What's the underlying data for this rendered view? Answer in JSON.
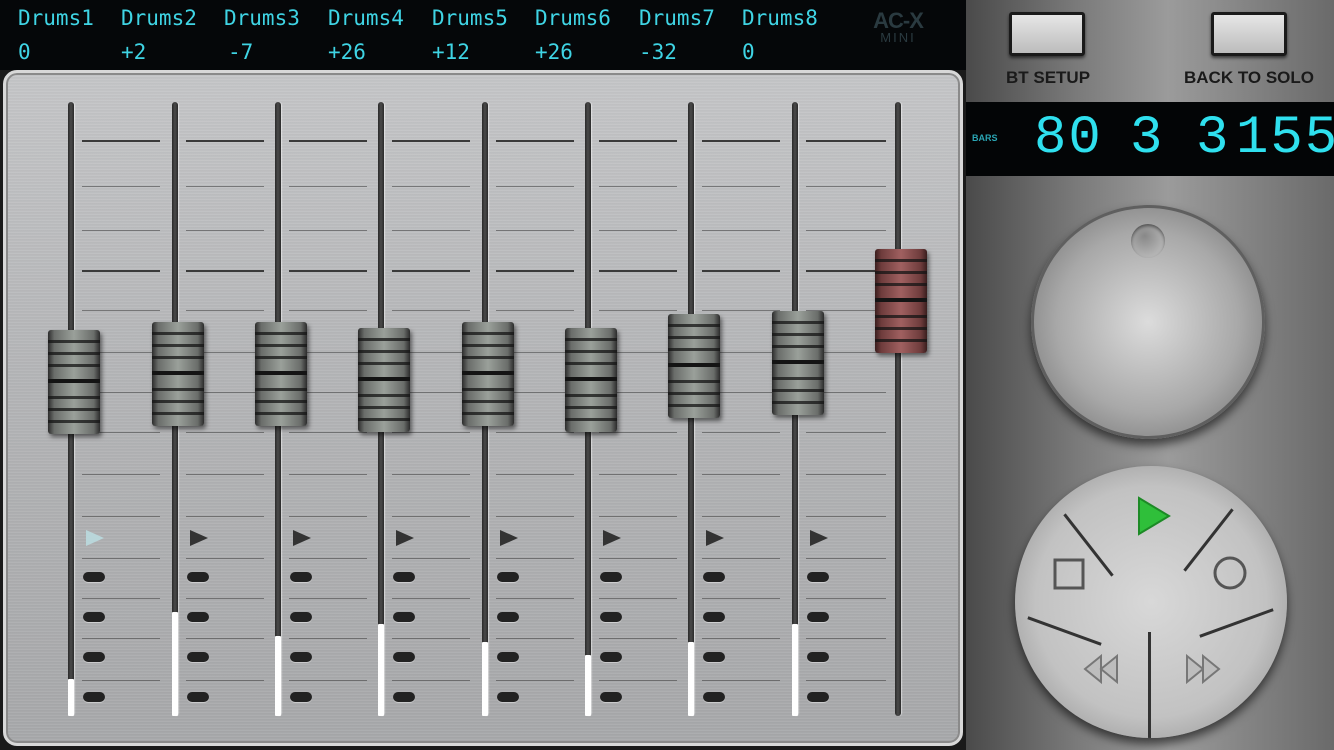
{
  "channels": [
    {
      "name": "Drums1",
      "value": "0",
      "fader_level": 0.42,
      "meter_level": 0.06,
      "active": true
    },
    {
      "name": "Drums2",
      "value": "+2",
      "fader_level": 0.45,
      "meter_level": 0.17,
      "active": false
    },
    {
      "name": "Drums3",
      "value": "-7",
      "fader_level": 0.45,
      "meter_level": 0.13,
      "active": false
    },
    {
      "name": "Drums4",
      "value": "+26",
      "fader_level": 0.43,
      "meter_level": 0.15,
      "active": false
    },
    {
      "name": "Drums5",
      "value": "+12",
      "fader_level": 0.45,
      "meter_level": 0.12,
      "active": false
    },
    {
      "name": "Drums6",
      "value": "+26",
      "fader_level": 0.43,
      "meter_level": 0.1,
      "active": false
    },
    {
      "name": "Drums7",
      "value": "-32",
      "fader_level": 0.48,
      "meter_level": 0.12,
      "active": false
    },
    {
      "name": "Drums8",
      "value": "0",
      "fader_level": 0.49,
      "meter_level": 0.15,
      "active": false
    }
  ],
  "master": {
    "fader_level": 0.71
  },
  "logo": {
    "line1": "AC-X",
    "line2": "MINI"
  },
  "buttons": {
    "bt_setup": "BT SETUP",
    "back_to_solo": "BACK TO SOLO"
  },
  "display": {
    "label": "BARS",
    "tempo": "80",
    "bar": "3",
    "beat": "3",
    "tick": "155"
  },
  "transport": {
    "play_icon": "play-icon",
    "stop_icon": "stop-icon",
    "record_icon": "record-icon",
    "rewind_icon": "rewind-icon",
    "fast_forward_icon": "fast-forward-icon",
    "play_color": "#2fbf3a"
  },
  "colors": {
    "display_text": "#3fd4e4"
  }
}
